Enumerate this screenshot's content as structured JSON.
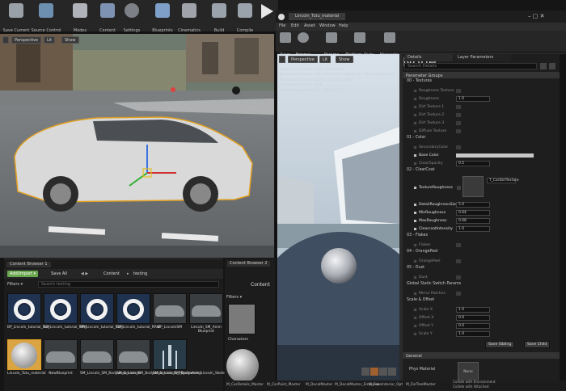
{
  "main_toolbar": {
    "buttons": [
      "Save Current",
      "Source Control",
      "Modes",
      "Content",
      "Settings",
      "Blueprints",
      "Cinematics",
      "Build",
      "Compile"
    ]
  },
  "viewport": {
    "perspective": "Perspective",
    "lit": "Lit",
    "show": "Show"
  },
  "content_browser_1": {
    "tab": "Content Browser 1",
    "add_import": "Add/Import ▾",
    "save_all": "Save All",
    "path": [
      "Content",
      "testing"
    ],
    "filters": "Filters ▾",
    "search_placeholder": "Search testing",
    "assets": [
      {
        "name": "BP_Lincoln_tutorial_FLW",
        "type": "wheel"
      },
      {
        "name": "BP_Lincoln_tutorial_FRW",
        "type": "wheel"
      },
      {
        "name": "BP_Lincoln_tutorial_RLW",
        "type": "wheel"
      },
      {
        "name": "BP_Lincoln_tutorial_RRW",
        "type": "wheel"
      },
      {
        "name": "BP_LincolnSM",
        "type": "car"
      },
      {
        "name": "Lincoln_SM_Anim Blueprint",
        "type": "car"
      },
      {
        "name": "Lincoln_Tutu_material",
        "type": "sphere"
      },
      {
        "name": "NewBlueprint",
        "type": "car"
      },
      {
        "name": "SM_Lincoln_SM_Bodywork_Lincoln",
        "type": "car"
      },
      {
        "name": "SM_Lincoln_SM_Bodywork_Lincoln_PhysicsAsset",
        "type": "car"
      },
      {
        "name": "SM_Lincoln_SM_Bodywork_Lincoln_Skeleton",
        "type": "skeleton"
      }
    ]
  },
  "content_browser_2": {
    "tab": "Content Browser 2",
    "path": "Content",
    "filters": "Filters ▾",
    "folders": [
      "Characters"
    ]
  },
  "material_editor": {
    "window_title": "Lincoln_Tutu_material",
    "menu": [
      "File",
      "Edit",
      "Asset",
      "Window",
      "Help"
    ],
    "toolbar": [
      "Save",
      "Browse",
      "Params",
      "Platform Stats",
      "Hierarchy"
    ],
    "viewport": {
      "perspective": "Perspective",
      "lit": "Lit",
      "show": "Show"
    },
    "stats": [
      "Base pass shader: 131 instructions",
      "Base pass shader with Volumetric Lightmap: 166 instructions",
      "Base pass vertex shader: 1 instructions",
      "Texture samplers: 5/16",
      "Texture Lookups (Est.): VS(3), PS(1)"
    ],
    "bottom_thumbs": [
      "M_CarDetails_Master",
      "M_CarPaint_Master",
      "M_DecalMaster",
      "M_DecalMaster_Emissive",
      "M_FakeInterior_Opt",
      "M_FarTreeMaster"
    ]
  },
  "details": {
    "tabs": [
      "Details",
      "Layer Parameters"
    ],
    "search_placeholder": "Search Details",
    "parameter_groups": "Parameter Groups",
    "sections": [
      {
        "title": "00 - Textures",
        "rows": [
          {
            "name": "Roughness Texture",
            "checked": false,
            "value": ""
          },
          {
            "name": "Roughness",
            "checked": false,
            "value": "1.0"
          },
          {
            "name": "Dirt Texture 1",
            "checked": false,
            "value": ""
          },
          {
            "name": "Dirt Texture 2",
            "checked": false,
            "value": ""
          },
          {
            "name": "Dirt Texture 3",
            "checked": false,
            "value": ""
          },
          {
            "name": "Diffuse Texture",
            "checked": false,
            "value": ""
          }
        ]
      },
      {
        "title": "01 - Color",
        "rows": [
          {
            "name": "SecondaryColor",
            "checked": false,
            "value": ""
          },
          {
            "name": "Base Color",
            "checked": true,
            "value": ""
          },
          {
            "name": "ClearOpacity",
            "checked": false,
            "value": "0.5"
          }
        ]
      },
      {
        "title": "02 - ClearCoat",
        "rows": [
          {
            "name": "TextureRoughness",
            "checked": true,
            "value": "T_CarDirtTexture"
          },
          {
            "name": "DetailRoughnessSize",
            "checked": true,
            "value": "5.0"
          },
          {
            "name": "MinRoughness",
            "checked": true,
            "value": "0.04"
          },
          {
            "name": "MaxRoughness",
            "checked": true,
            "value": "0.08"
          },
          {
            "name": "ClearcoatIntensity",
            "checked": true,
            "value": "1.0"
          }
        ]
      },
      {
        "title": "03 - Flakes",
        "rows": [
          {
            "name": "Flakes",
            "checked": false,
            "value": ""
          }
        ]
      },
      {
        "title": "04 - OrangePeel",
        "rows": [
          {
            "name": "OrangePeel",
            "checked": false,
            "value": ""
          }
        ]
      },
      {
        "title": "05 - Dust",
        "rows": [
          {
            "name": "Dust",
            "checked": false,
            "value": ""
          }
        ]
      },
      {
        "title": "Global Static Switch Params",
        "rows": [
          {
            "name": "Mirror Patches",
            "checked": false,
            "value": ""
          }
        ]
      },
      {
        "title": "Scale & Offset",
        "rows": [
          {
            "name": "Scale X",
            "checked": false,
            "value": "1.0"
          },
          {
            "name": "Offset X",
            "checked": false,
            "value": "0.0"
          },
          {
            "name": "Offset Y",
            "checked": false,
            "value": "0.0"
          },
          {
            "name": "Scale Y",
            "checked": false,
            "value": "1.0"
          }
        ]
      }
    ],
    "save_sibling": "Save Sibling",
    "save_child": "Save Child",
    "general": "General",
    "phys_material": "Phys Material",
    "phys_value": "None",
    "phys_thumb": "None",
    "bottom_checkboxes": [
      "Collide with Environment",
      "Collide with Attached"
    ]
  },
  "colors": {
    "accent_green": "#6aa84f",
    "selection_orange": "#e3a020",
    "panel_bg": "#1e1e1e"
  }
}
